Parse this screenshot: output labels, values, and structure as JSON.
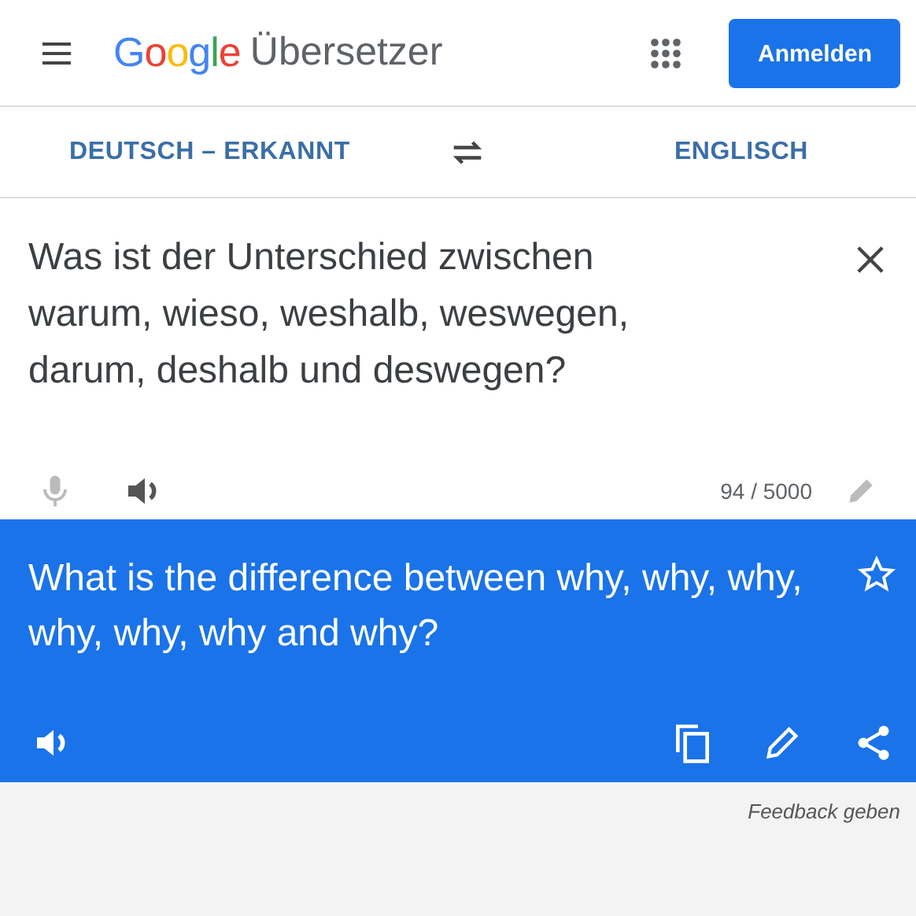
{
  "header": {
    "logo": [
      {
        "char": "G",
        "color": "#4285f4"
      },
      {
        "char": "o",
        "color": "#ea4335"
      },
      {
        "char": "o",
        "color": "#fbbc05"
      },
      {
        "char": "g",
        "color": "#4285f4"
      },
      {
        "char": "l",
        "color": "#34a853"
      },
      {
        "char": "e",
        "color": "#ea4335"
      }
    ],
    "app_name": "Übersetzer",
    "sign_in": "Anmelden"
  },
  "languages": {
    "source": "DEUTSCH – ERKANNT",
    "target": "ENGLISCH"
  },
  "source": {
    "value": "Was ist der Unterschied zwischen warum, wieso, weshalb, weswegen, darum, deshalb und deswegen?",
    "mic_disabled": true,
    "edit_disabled": true,
    "count": "94 / 5000"
  },
  "translation": {
    "text": "What is the difference between why, why, why, why, why, why and why?",
    "starred": false
  },
  "feedback": "Feedback geben"
}
